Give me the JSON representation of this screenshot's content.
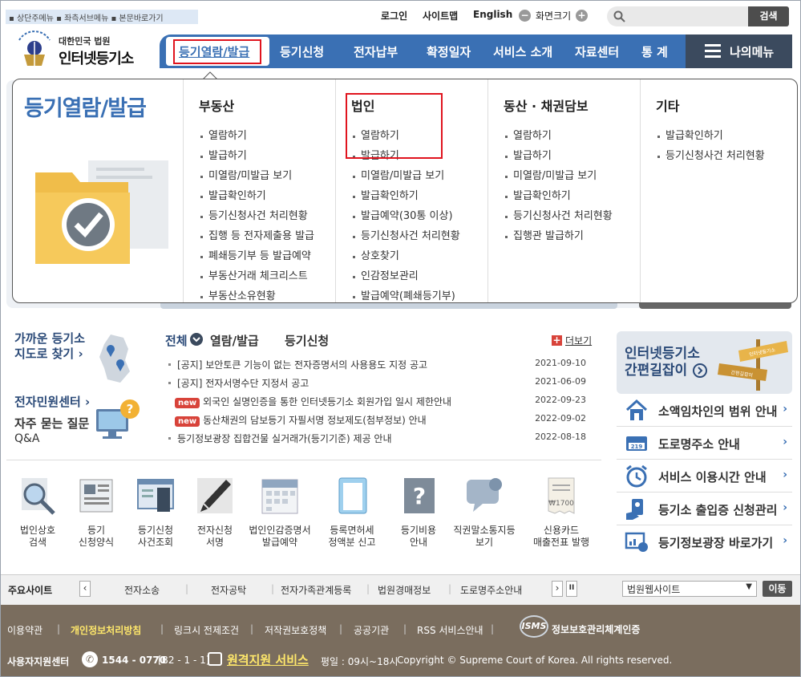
{
  "skip_links": "▪ 상단주메뉴 ▪ 좌측서브메뉴 ▪ 본문바로가기",
  "util": {
    "login": "로그인",
    "sitemap": "사이트맵",
    "english": "English",
    "screen_size": "화면크기",
    "minus": "−",
    "plus": "+"
  },
  "search": {
    "placeholder": "",
    "button": "검색"
  },
  "logo": {
    "sub": "대한민국 법원",
    "main": "인터넷등기소"
  },
  "nav": {
    "items": [
      "등기열람/발급",
      "등기신청",
      "전자납부",
      "확정일자",
      "서비스 소개",
      "자료센터",
      "통 계"
    ],
    "my_menu": "나의메뉴"
  },
  "dropdown": {
    "title": "등기열람/발급",
    "columns": [
      {
        "title": "부동산",
        "items": [
          "열람하기",
          "발급하기",
          "미열람/미발급 보기",
          "발급확인하기",
          "등기신청사건 처리현황",
          "집행 등 전자제출용 발급",
          "폐쇄등기부 등 발급예약",
          "부동산거래 체크리스트",
          "부동산소유현황"
        ]
      },
      {
        "title": "법인",
        "items": [
          "열람하기",
          "발급하기",
          "미열람/미발급 보기",
          "발급확인하기",
          "발급예약(30통 이상)",
          "등기신청사건 처리현황",
          "상호찾기",
          "인감정보관리",
          "발급예약(폐쇄등기부)"
        ]
      },
      {
        "title": "동산 · 채권담보",
        "items": [
          "열람하기",
          "발급하기",
          "미열람/미발급 보기",
          "발급확인하기",
          "등기신청사건 처리현황",
          "집행관 발급하기"
        ]
      },
      {
        "title": "기타",
        "items": [
          "발급확인하기",
          "등기신청사건 처리현황"
        ]
      }
    ]
  },
  "quick": {
    "nearby": [
      "가까운 등기소",
      "지도로 찾기 ›"
    ],
    "civil": "전자민원센터 ›",
    "faq": [
      "자주 묻는 질문",
      "Q&A"
    ]
  },
  "notices": {
    "tabs": [
      "전체",
      "열람/발급",
      "등기신청"
    ],
    "more": "더보기",
    "items": [
      {
        "text": "[공지] 보안토큰 기능이 없는 전자증명서의 사용용도 지정 공고",
        "date": "2021-09-10",
        "new": ""
      },
      {
        "text": "[공지] 전자서명수단 지정서 공고",
        "date": "2021-06-09",
        "new": ""
      },
      {
        "text": "외국인 실명인증을 통한 인터넷등기소 회원가입 일시 제한안내",
        "date": "2022-09-23",
        "new": "new"
      },
      {
        "text": "동산채권의 담보등기 자필서명 정보제도(첨부정보) 안내",
        "date": "2022-09-02",
        "new": "new"
      },
      {
        "text": "등기정보광장 집합건물 실거래가(등기기준) 제공 안내",
        "date": "2022-08-18",
        "new": ""
      }
    ]
  },
  "services": [
    [
      "법인상호",
      "검색"
    ],
    [
      "등기",
      "신청양식"
    ],
    [
      "등기신청",
      "사건조회"
    ],
    [
      "전자신청",
      "서명"
    ],
    [
      "법인인감증명서",
      "발급예약"
    ],
    [
      "등록면허세",
      "정액분 신고"
    ],
    [
      "등기비용",
      "안내"
    ],
    [
      "직권말소통지등",
      "보기"
    ],
    [
      "신용카드",
      "매출전표 발행"
    ]
  ],
  "right": {
    "banner": [
      "인터넷등기소",
      "간편길잡이"
    ],
    "sign": [
      "인터넷등기소",
      "간편길잡이"
    ],
    "items": [
      "소액임차인의 범위 안내",
      "도로명주소 안내",
      "서비스 이용시간 안내",
      "등기소 출입증 신청관리",
      "등기정보광장 바로가기"
    ]
  },
  "sites": {
    "label": "주요사이트",
    "items": [
      "전자소송",
      "전자공탁",
      "전자가족관계등록",
      "법원경매정보",
      "도로명주소안내"
    ],
    "select": "법원웹사이트",
    "go": "이동"
  },
  "footer": {
    "links": [
      "이용약관",
      "개인정보처리방침",
      "링크시 전제조건",
      "저작권보호정책",
      "공공기관",
      "RSS 서비스안내"
    ],
    "isms": "정보보호관리체계인증",
    "isms_logo": "ISMS",
    "support": "사용자지원센터",
    "phone": "1544 - 0770",
    "phone_note": "[B2 - 1 - 1]",
    "remote": "원격지원 서비스",
    "hours": "평일 : 09시~18시",
    "copyright": "Copyright © Supreme Court of Korea. All rights reserved."
  },
  "colors": {
    "brand": "#3a70b4",
    "highlight": "#e0141e",
    "footer": "#7a6d5e"
  }
}
